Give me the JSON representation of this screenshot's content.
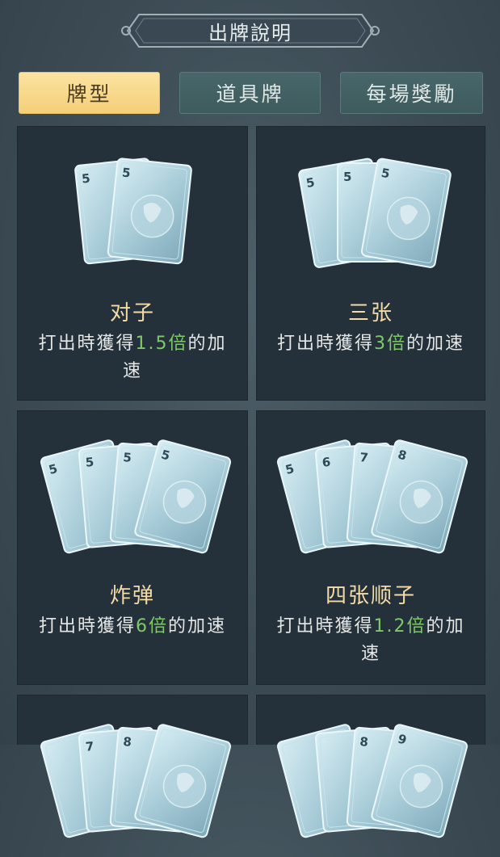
{
  "header": {
    "title": "出牌說明"
  },
  "tabs": [
    {
      "label": "牌型",
      "active": true
    },
    {
      "label": "道具牌",
      "active": false
    },
    {
      "label": "每場獎勵",
      "active": false
    }
  ],
  "cards": [
    {
      "name": "对子",
      "ranks": [
        "5",
        "5"
      ],
      "desc_before": "打出時獲得",
      "highlight": "1.5倍",
      "desc_after": "的加速"
    },
    {
      "name": "三张",
      "ranks": [
        "5",
        "5",
        "5"
      ],
      "desc_before": "打出時獲得",
      "highlight": "3倍",
      "desc_after": "的加速"
    },
    {
      "name": "炸弹",
      "ranks": [
        "5",
        "5",
        "5",
        "5"
      ],
      "desc_before": "打出時獲得",
      "highlight": "6倍",
      "desc_after": "的加速"
    },
    {
      "name": "四张顺子",
      "ranks": [
        "5",
        "6",
        "7",
        "8"
      ],
      "desc_before": "打出時獲得",
      "highlight": "1.2倍",
      "desc_after": "的加速"
    },
    {
      "name": "",
      "ranks": [
        "",
        "7",
        "8",
        ""
      ]
    },
    {
      "name": "",
      "ranks": [
        "",
        "",
        "8",
        "9"
      ]
    }
  ],
  "colors": {
    "accent": "#f4cf78",
    "highlight": "#7fc96a",
    "card_title": "#f3dca7"
  }
}
